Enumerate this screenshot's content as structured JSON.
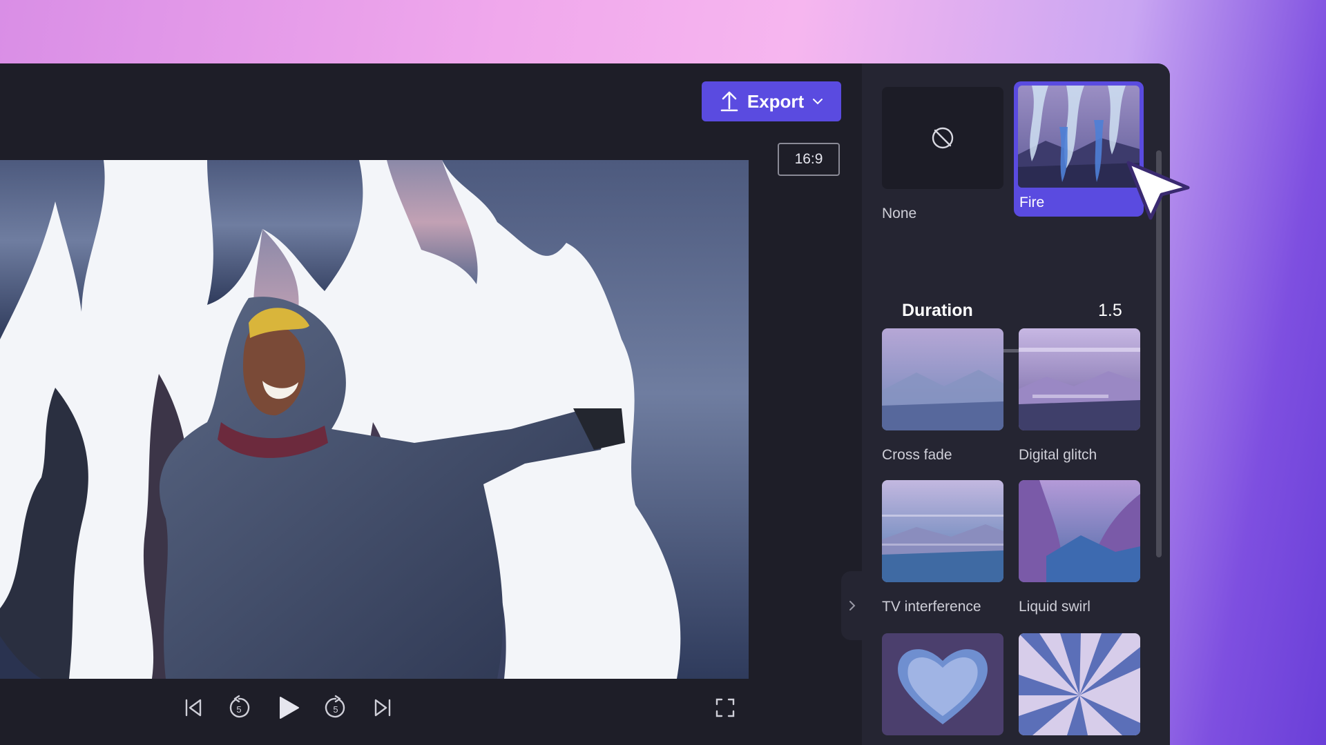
{
  "toolbar": {
    "export_label": "Export",
    "aspect_ratio": "16:9"
  },
  "player": {
    "controls": [
      "skip-to-start-icon",
      "rewind-5-icon",
      "play-icon",
      "forward-5-icon",
      "skip-to-end-icon",
      "fullscreen-icon"
    ],
    "rewind_seconds": "5",
    "forward_seconds": "5"
  },
  "transitions": {
    "items": [
      {
        "label": "None",
        "selected": false
      },
      {
        "label": "Fire",
        "selected": true
      },
      {
        "label": "Cross fade",
        "selected": false
      },
      {
        "label": "Digital glitch",
        "selected": false
      },
      {
        "label": "TV interference",
        "selected": false
      },
      {
        "label": "Liquid swirl",
        "selected": false
      }
    ]
  },
  "duration": {
    "label": "Duration",
    "value": "1.5",
    "slider_fraction": 0.27
  },
  "colors": {
    "accent": "#5a4be0",
    "slider": "#8c7ef2",
    "panel": "#252532",
    "editor": "#1e1e28"
  }
}
